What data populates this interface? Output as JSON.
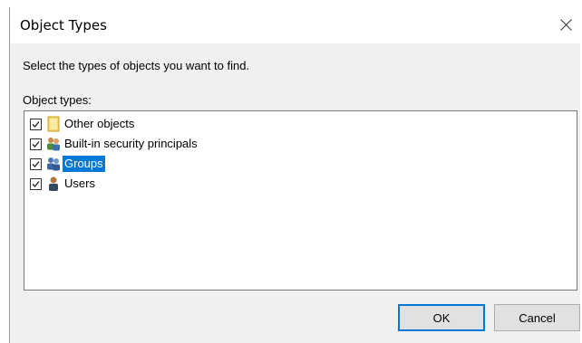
{
  "window": {
    "title": "Object Types",
    "close_icon": "close-icon"
  },
  "instruction": "Select the types of objects you want to find.",
  "list": {
    "label": "Object types:",
    "items": [
      {
        "label": "Other objects",
        "checked": true,
        "icon": "folder-icon",
        "selected": false
      },
      {
        "label": "Built-in security principals",
        "checked": true,
        "icon": "security-principals-icon",
        "selected": false
      },
      {
        "label": "Groups",
        "checked": true,
        "icon": "group-icon",
        "selected": true
      },
      {
        "label": "Users",
        "checked": true,
        "icon": "user-icon",
        "selected": false
      }
    ]
  },
  "buttons": {
    "ok_label": "OK",
    "cancel_label": "Cancel"
  },
  "colors": {
    "selection": "#0078d7",
    "dialog_bg": "#f0f0f0",
    "default_button_border": "#0078d7"
  }
}
